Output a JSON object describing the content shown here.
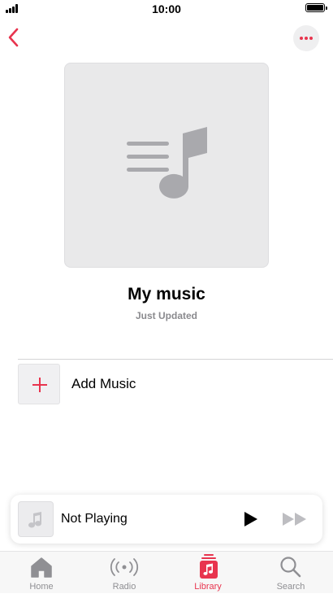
{
  "status_bar": {
    "time": "10:00"
  },
  "playlist": {
    "title": "My music",
    "subtitle": "Just Updated"
  },
  "actions": {
    "add_music_label": "Add Music"
  },
  "mini_player": {
    "title": "Not Playing"
  },
  "tab_bar": {
    "tabs": [
      {
        "label": "Home",
        "icon": "house-icon",
        "active": false
      },
      {
        "label": "Radio",
        "icon": "radio-waves-icon",
        "active": false
      },
      {
        "label": "Library",
        "icon": "music-note-square-icon",
        "active": true
      },
      {
        "label": "Search",
        "icon": "magnifying-glass-icon",
        "active": false
      }
    ]
  },
  "colors": {
    "accent": "#e8344e",
    "inactive": "#8f8f93",
    "artwork_bg": "#e9e9ea"
  }
}
